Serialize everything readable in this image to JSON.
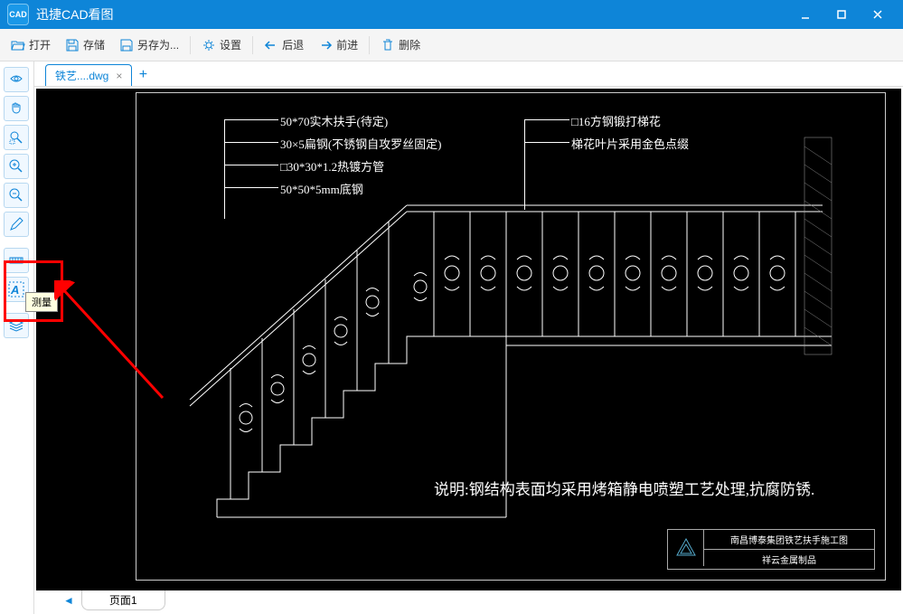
{
  "app": {
    "title": "迅捷CAD看图"
  },
  "window": {
    "min": "—",
    "max": "☐",
    "close": "✕"
  },
  "toolbar": {
    "open": "打开",
    "save": "存储",
    "saveas": "另存为...",
    "settings": "设置",
    "back": "后退",
    "forward": "前进",
    "delete": "删除"
  },
  "tabs": {
    "file": "铁艺....dwg"
  },
  "sheet": {
    "name": "页面1"
  },
  "tooltip": {
    "measure": "测量"
  },
  "drawing": {
    "labels": {
      "l1": "50*70实木扶手(待定)",
      "l2": "30×5扁钢(不锈钢自攻罗丝固定)",
      "l3": "□30*30*1.2热镀方管",
      "l4": "50*50*5mm底钢",
      "r1": "□16方钢锻打梯花",
      "r2": "梯花叶片采用金色点缀"
    },
    "note": "说明:钢结构表面均采用烤箱静电喷塑工艺处理,抗腐防锈.",
    "titleblock": {
      "t1": "南昌博泰集团铁艺扶手施工图",
      "t2": "祥云金属制品"
    }
  }
}
